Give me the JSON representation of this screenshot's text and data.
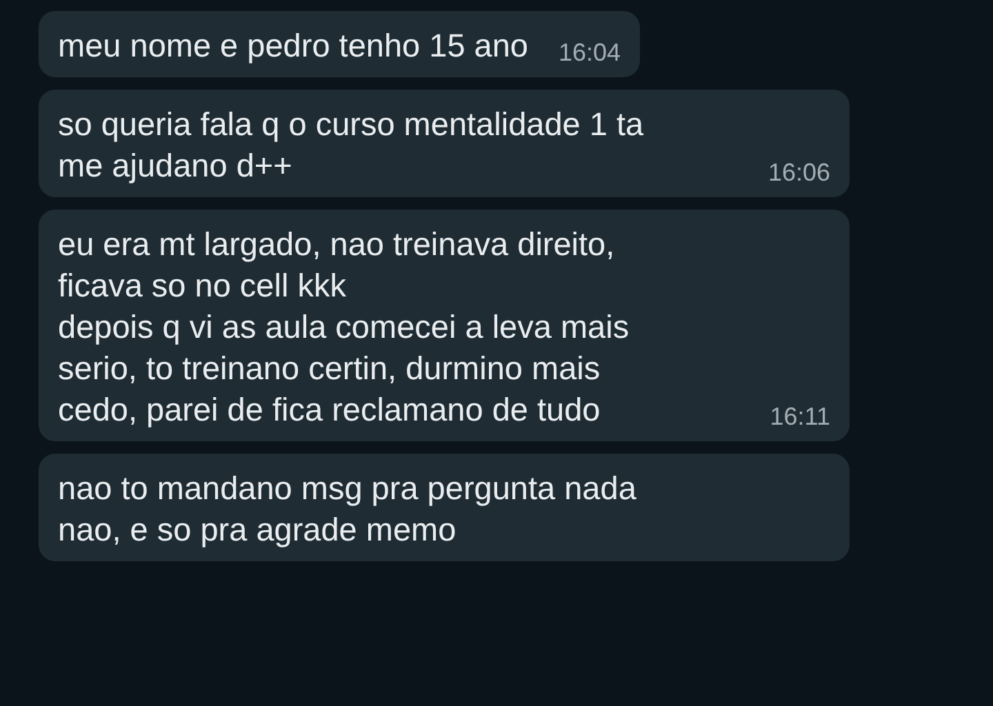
{
  "messages": [
    {
      "text": "meu nome e pedro tenho 15 ano",
      "time": "16:04"
    },
    {
      "text": "so queria fala q o curso mentalidade 1 ta\nme ajudano d++",
      "time": "16:06"
    },
    {
      "text": "eu era mt largado, nao treinava direito,\nficava so no cell kkk\ndepois q vi as aula comecei a leva mais\nserio, to treinano certin, durmino mais\ncedo, parei de fica reclamano de tudo",
      "time": "16:11"
    },
    {
      "text": "nao to mandano msg pra pergunta nada\nnao, e so pra agrade memo"
    }
  ]
}
